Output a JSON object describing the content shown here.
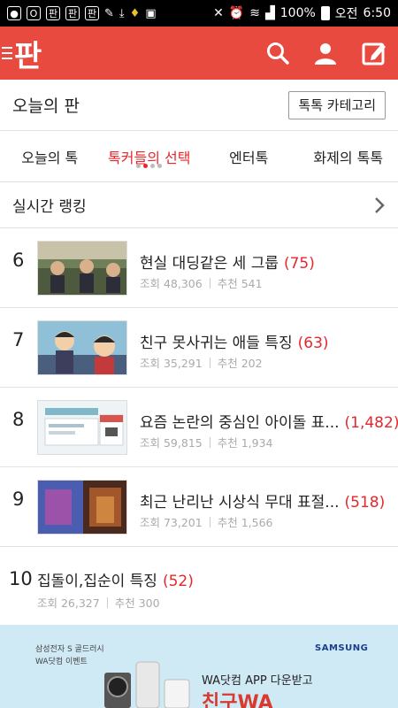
{
  "status_bar": {
    "left_icons": [
      "app-notification-icon",
      "o-icon",
      "pan-icon",
      "pan-icon",
      "pan-icon",
      "broom-icon",
      "download-icon",
      "ribbon-icon",
      "image-icon"
    ],
    "battery": "100%",
    "ampm": "오전",
    "time": "6:50"
  },
  "app_bar": {
    "logo": "판",
    "color": "#e84a3f"
  },
  "today": {
    "title": "오늘의 판",
    "category_button": "톡톡 카테고리"
  },
  "tabs": [
    {
      "label": "오늘의 톡",
      "active": false
    },
    {
      "label": "톡커들의 선택",
      "active": true
    },
    {
      "label": "엔터톡",
      "active": false
    },
    {
      "label": "화제의 톡톡",
      "active": false
    }
  ],
  "ranking": {
    "title": "실시간 랭킹"
  },
  "items": [
    {
      "rank": "6",
      "title": "현실 대딩같은 세 그룹",
      "comments": "(75)",
      "views": "조회 48,306",
      "likes": "추천 541"
    },
    {
      "rank": "7",
      "title": "친구 못사귀는 애들 특징",
      "comments": "(63)",
      "views": "조회 35,291",
      "likes": "추천 202"
    },
    {
      "rank": "8",
      "title": "요즘 논란의 중심인 아이돌 표...",
      "comments": "(1,482)",
      "views": "조회 59,815",
      "likes": "추천 1,934"
    },
    {
      "rank": "9",
      "title": "최근 난리난 시상식 무대 표절...",
      "comments": "(518)",
      "views": "조회 73,201",
      "likes": "추천 1,566"
    },
    {
      "rank": "10",
      "title": "집돌이,집순이 특징",
      "comments": "(52)",
      "views": "조회 26,327",
      "likes": "추천 300"
    }
  ],
  "ad": {
    "brand": "삼성전자 S 골드러시",
    "event": "WA닷컴 이벤트",
    "samsung": "SAMSUNG",
    "line1": "WA닷컴 APP 다운받고",
    "line2": "친구WA"
  }
}
